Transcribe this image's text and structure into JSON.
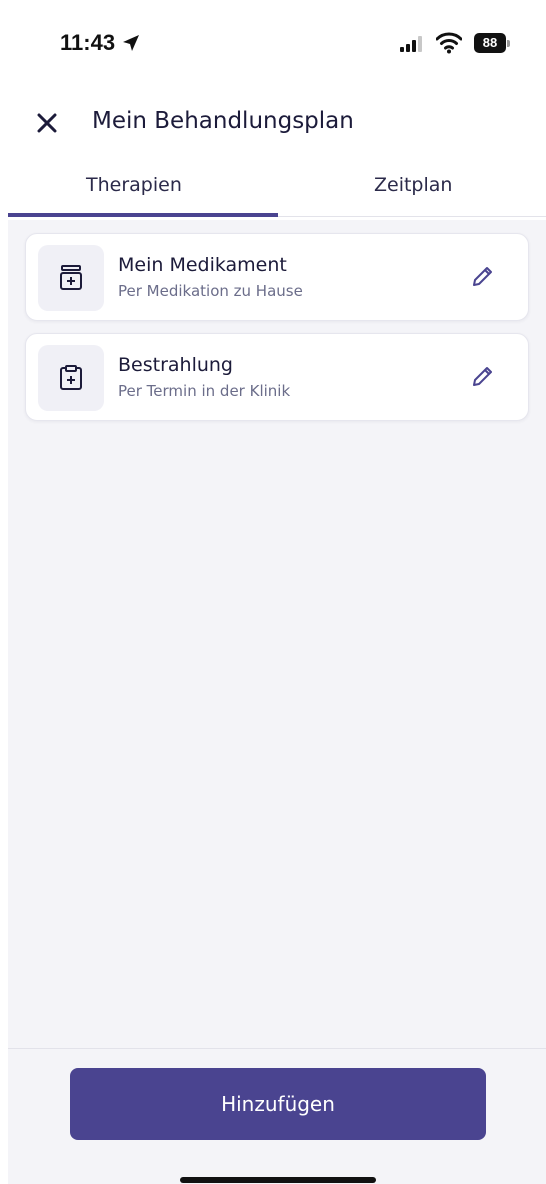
{
  "status_bar": {
    "time": "11:43",
    "battery": "88"
  },
  "header": {
    "title": "Mein Behandlungsplan",
    "close_icon": "close-icon"
  },
  "tabs": [
    {
      "label": "Therapien",
      "active": true
    },
    {
      "label": "Zeitplan",
      "active": false
    }
  ],
  "therapies": [
    {
      "title": "Mein Medikament",
      "subtitle": "Per Medikation zu Hause",
      "icon": "medication-icon"
    },
    {
      "title": "Bestrahlung",
      "subtitle": "Per Termin in der Klinik",
      "icon": "clipboard-medical-icon"
    }
  ],
  "footer": {
    "add_label": "Hinzufügen"
  },
  "colors": {
    "accent": "#4a4490",
    "text_primary": "#1c1b3a",
    "text_secondary": "#6b6d8a",
    "background": "#f4f4f8"
  }
}
